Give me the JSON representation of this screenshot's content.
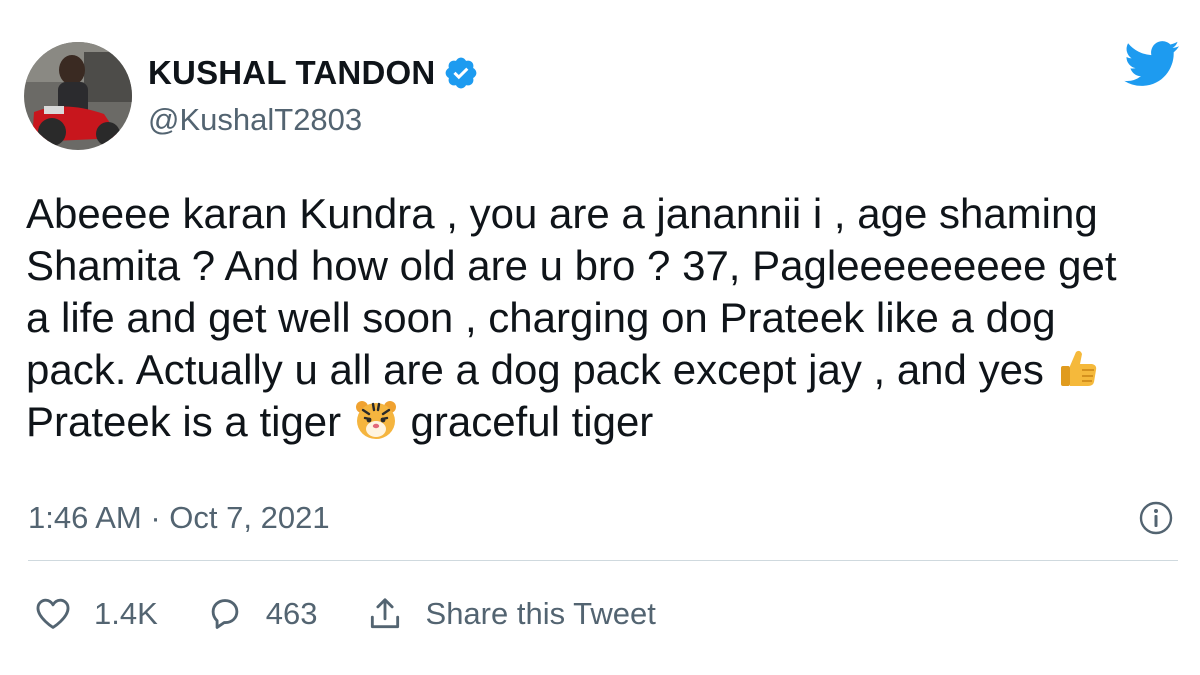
{
  "user": {
    "display_name": "KUSHAL TANDON",
    "handle": "@KushalT2803",
    "verified": true,
    "avatar_icon": "profile-photo"
  },
  "tweet": {
    "lines": [
      "Abeeee karan Kundra , you are a janannii i , age shaming",
      "Shamita ? And how old are u bro ? 37, Pagleeeeeeeee get",
      "a life and get well soon , charging on Prateek like a dog",
      "pack. Actually u all are a dog pack except jay , and yes",
      "Prateek is a tiger",
      "graceful tiger"
    ],
    "emojis": [
      "thumbs-up-icon",
      "tiger-face-icon"
    ],
    "timestamp": "1:46 AM · Oct 7, 2021"
  },
  "actions": {
    "likes": "1.4K",
    "replies": "463",
    "share_label": "Share this Tweet"
  },
  "colors": {
    "brand": "#1d9bf0",
    "text": "#0f1419",
    "secondary": "#536471",
    "divider": "#cfd9de"
  }
}
